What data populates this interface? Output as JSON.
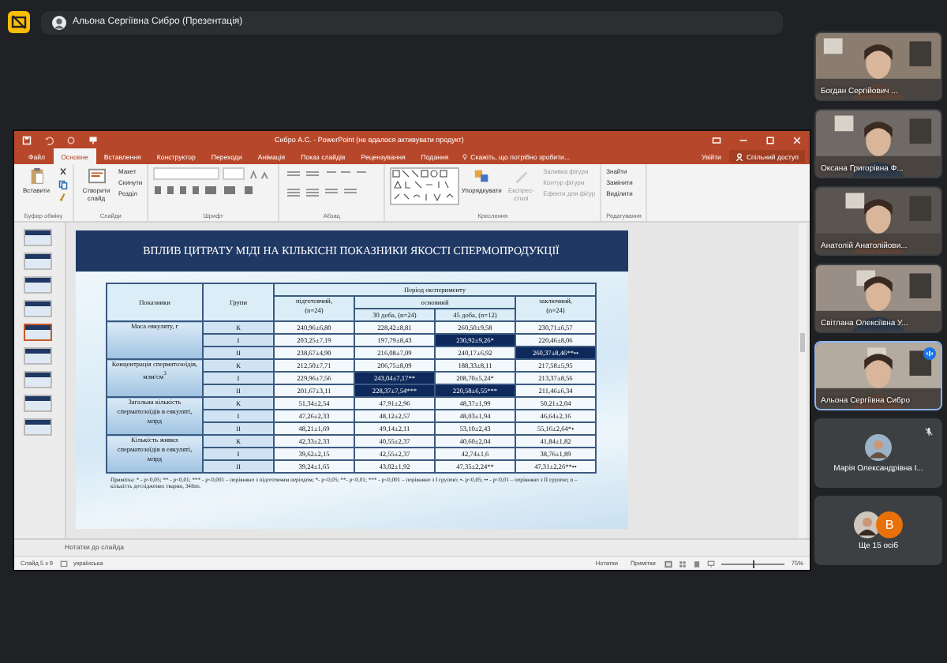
{
  "presenter_chip": {
    "label": "Альона Сергіївна Сибро (Презентація)"
  },
  "powerpoint": {
    "title": "Сибро А.С. - PowerPoint (не вдалося активувати продукт)",
    "tabs": [
      {
        "label": "Файл",
        "selected": false
      },
      {
        "label": "Основне",
        "selected": true
      },
      {
        "label": "Вставлення",
        "selected": false
      },
      {
        "label": "Конструктор",
        "selected": false
      },
      {
        "label": "Переходи",
        "selected": false
      },
      {
        "label": "Анімація",
        "selected": false
      },
      {
        "label": "Показ слайдів",
        "selected": false
      },
      {
        "label": "Рецензування",
        "selected": false
      },
      {
        "label": "Подання",
        "selected": false
      }
    ],
    "tell_me": "Скажіть, що потрібно зробити...",
    "sign_in": "Увійти",
    "share": "Спільний доступ",
    "ribbon_groups": [
      {
        "label": "Буфер обміну",
        "kind": "clipboard",
        "items": [
          "Вставити"
        ]
      },
      {
        "label": "Слайди",
        "kind": "slides",
        "items": [
          "Створити слайд",
          "Макет",
          "Скинути",
          "Розділ"
        ]
      },
      {
        "label": "Шрифт",
        "kind": "font"
      },
      {
        "label": "Абзац",
        "kind": "paragraph"
      },
      {
        "label": "Креслення",
        "kind": "drawing",
        "items": [
          "Упорядкувати",
          "Експрес-стилі",
          "Заливка фігури",
          "Контур фігури",
          "Ефекти для фігур"
        ]
      },
      {
        "label": "Редагування",
        "kind": "editing",
        "items": [
          "Знайти",
          "Замінити",
          "Виділити"
        ]
      }
    ],
    "thumbnails": [
      {
        "selected": false
      },
      {
        "selected": false
      },
      {
        "selected": false
      },
      {
        "selected": false
      },
      {
        "selected": true
      },
      {
        "selected": false
      },
      {
        "selected": false
      },
      {
        "selected": false
      },
      {
        "selected": false
      }
    ],
    "slide": {
      "title": "ВПЛИВ ЦИТРАТУ МІДІ НА КІЛЬКІСНІ ПОКАЗНИКИ ЯКОСТІ СПЕРМОПРОДУКЦІЇ",
      "table": {
        "col_indicator": "Показники",
        "col_group": "Групи",
        "period": "Період експерименту",
        "periods": [
          {
            "label": "підготовчий,",
            "n": "(n=24)"
          },
          {
            "label": "основний",
            "subs": [
              {
                "label": "30 доба, (n=24)"
              },
              {
                "label": "45 доба, (n=12)"
              }
            ]
          },
          {
            "label": "заключний,",
            "n": "(n=24)"
          }
        ],
        "rows": [
          {
            "indicator": "Маса еякуляту, г",
            "groups": [
              {
                "group": "К",
                "cells": [
                  {
                    "text": "240,96±6,80",
                    "highlighted": false
                  },
                  {
                    "text": "228,42±8,81",
                    "highlighted": false
                  },
                  {
                    "text": "260,50±9,58",
                    "highlighted": false
                  },
                  {
                    "text": "230,71±6,57",
                    "highlighted": false
                  }
                ]
              },
              {
                "group": "І",
                "cells": [
                  {
                    "text": "203,25±7,19",
                    "highlighted": false
                  },
                  {
                    "text": "197,79±8,43",
                    "highlighted": false
                  },
                  {
                    "text": "230,92±9,26*",
                    "highlighted": true
                  },
                  {
                    "text": "220,46±8,06",
                    "highlighted": false
                  }
                ]
              },
              {
                "group": "ІІ",
                "cells": [
                  {
                    "text": "238,67±4,90",
                    "highlighted": false
                  },
                  {
                    "text": "216,08±7,09",
                    "highlighted": false
                  },
                  {
                    "text": "240,17±6,92",
                    "highlighted": false
                  },
                  {
                    "text": "260,37±8,46**••",
                    "highlighted": true
                  }
                ]
              }
            ]
          },
          {
            "indicator": "Концентрація сперматозоїдів, млн/см$^{3}$",
            "groups": [
              {
                "group": "К",
                "cells": [
                  {
                    "text": "212,50±7,71",
                    "highlighted": false
                  },
                  {
                    "text": "206,75±8,09",
                    "highlighted": false
                  },
                  {
                    "text": "188,33±8,11",
                    "highlighted": false
                  },
                  {
                    "text": "217,58±5,95",
                    "highlighted": false
                  }
                ]
              },
              {
                "group": "І",
                "cells": [
                  {
                    "text": "229,96±7,56",
                    "highlighted": false
                  },
                  {
                    "text": "243,04±7,17**",
                    "highlighted": true
                  },
                  {
                    "text": "208,70±5,24*",
                    "highlighted": false
                  },
                  {
                    "text": "213,37±8,56",
                    "highlighted": false
                  }
                ]
              },
              {
                "group": "ІІ",
                "cells": [
                  {
                    "text": "201,67±3,11",
                    "highlighted": false
                  },
                  {
                    "text": "228,37±7,54***",
                    "highlighted": true
                  },
                  {
                    "text": "220,58±6,55***",
                    "highlighted": true
                  },
                  {
                    "text": "211,46±6,34",
                    "highlighted": false
                  }
                ]
              }
            ]
          },
          {
            "indicator": "Загальна кількість сперматозоїдів в еякуляті, млрд",
            "groups": [
              {
                "group": "К",
                "cells": [
                  {
                    "text": "51,34±2,54",
                    "highlighted": false
                  },
                  {
                    "text": "47,91±2,96",
                    "highlighted": false
                  },
                  {
                    "text": "48,37±1,99",
                    "highlighted": false
                  },
                  {
                    "text": "50,21±2,04",
                    "highlighted": false
                  }
                ]
              },
              {
                "group": "І",
                "cells": [
                  {
                    "text": "47,26±2,33",
                    "highlighted": false
                  },
                  {
                    "text": "48,12±2,57",
                    "highlighted": false
                  },
                  {
                    "text": "48,03±1,94",
                    "highlighted": false
                  },
                  {
                    "text": "46,64±2,16",
                    "highlighted": false
                  }
                ]
              },
              {
                "group": "ІІ",
                "cells": [
                  {
                    "text": "48,21±1,69",
                    "highlighted": false
                  },
                  {
                    "text": "49,14±2,11",
                    "highlighted": false
                  },
                  {
                    "text": "53,10±2,43",
                    "highlighted": false
                  },
                  {
                    "text": "55,16±2,64*•",
                    "highlighted": false
                  }
                ]
              }
            ]
          },
          {
            "indicator": "Кількість живих сперматозоїдів в еякуляті, млрд",
            "groups": [
              {
                "group": "К",
                "cells": [
                  {
                    "text": "42,33±2,33",
                    "highlighted": false
                  },
                  {
                    "text": "40,55±2,37",
                    "highlighted": false
                  },
                  {
                    "text": "40,60±2,04",
                    "highlighted": false
                  },
                  {
                    "text": "41,84±1,82",
                    "highlighted": false
                  }
                ]
              },
              {
                "group": "І",
                "cells": [
                  {
                    "text": "39,62±2,15",
                    "highlighted": false
                  },
                  {
                    "text": "42,55±2,37",
                    "highlighted": false
                  },
                  {
                    "text": "42,74±1,6",
                    "highlighted": false
                  },
                  {
                    "text": "38,76±1,89",
                    "highlighted": false
                  }
                ]
              },
              {
                "group": "ІІ",
                "cells": [
                  {
                    "text": "39,24±1,65",
                    "highlighted": false
                  },
                  {
                    "text": "43,02±1,92",
                    "highlighted": false
                  },
                  {
                    "text": "47,35±2,24**",
                    "highlighted": false
                  },
                  {
                    "text": "47,31±2,26**••",
                    "highlighted": false
                  }
                ]
              }
            ]
          }
        ]
      },
      "note": "Примітка: * - p<0,05; ** - p<0,01; *** - p<0,001 – порівняно з підготовчим періодом; *- p<0,05; **- p<0,01; *** - p<0,001 – порівняно з І групою; •- p<0,05; •• - p<0,01 – порівняно з ІІ групою; n – кількість досліджених тварин, 34fms."
    },
    "notes_placeholder": "Нотатки до слайда",
    "status": {
      "slide": "Слайд 5 з 9",
      "language": "українська",
      "notes": "Нотатки",
      "comments": "Примітки",
      "zoom": "75%",
      "zoom_slider": {
        "level": 0.5
      }
    }
  },
  "participants": [
    {
      "kind": "video",
      "name": "Богдан Сергійович ...",
      "speaking": false,
      "muted": false
    },
    {
      "kind": "video",
      "name": "Оксана Григорівна Ф...",
      "speaking": false,
      "muted": false
    },
    {
      "kind": "video",
      "name": "Анатолій Анатолійови...",
      "speaking": false,
      "muted": false
    },
    {
      "kind": "video",
      "name": "Світлана Олексіївна У...",
      "speaking": false,
      "muted": false
    },
    {
      "kind": "video",
      "name": "Альона Сергіївна Сибро",
      "speaking": true,
      "muted": false
    },
    {
      "kind": "avatar",
      "name": "Марія Олександрівна І...",
      "speaking": false,
      "muted": true
    },
    {
      "kind": "more",
      "name": "Ще 15 осіб",
      "letter": "В"
    }
  ]
}
